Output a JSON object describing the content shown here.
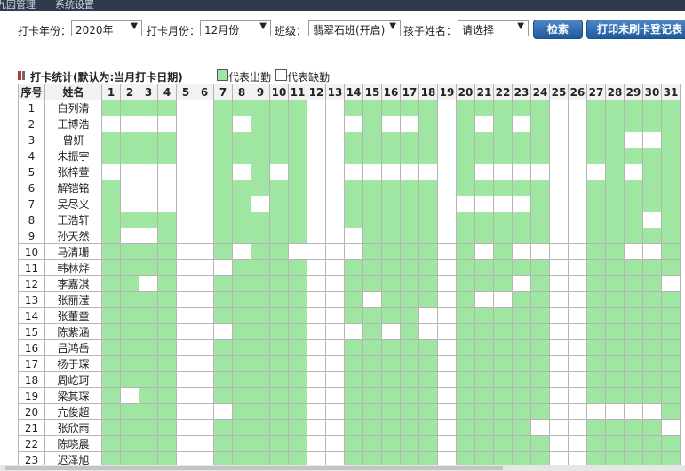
{
  "nav": [
    "九园管理",
    "系统设置"
  ],
  "filters": {
    "year_label": "打卡年份：",
    "year_value": "2020年",
    "month_label": "打卡月份：",
    "month_value": "12月份",
    "class_label": "班级：",
    "class_value": "翡翠石班(开启)",
    "child_label": "孩子姓名：",
    "child_value": "请选择",
    "search_btn": "检索",
    "print_btn": "打印未刷卡登记表"
  },
  "section": {
    "title": "打卡统计(默认为:当月打卡日期)",
    "legend_present": "代表出勤",
    "legend_absent": "代表缺勤"
  },
  "colors": {
    "present": "#9ee6a1",
    "absent": "#ffffff",
    "button": "#1f5a9e"
  },
  "table": {
    "col_index": "序号",
    "col_name": "姓名",
    "days": [
      "1",
      "2",
      "3",
      "4",
      "5",
      "6",
      "7",
      "8",
      "9",
      "10",
      "11",
      "12",
      "13",
      "14",
      "15",
      "16",
      "17",
      "18",
      "19",
      "20",
      "21",
      "22",
      "23",
      "24",
      "25",
      "26",
      "27",
      "28",
      "29",
      "30",
      "31"
    ],
    "rows": [
      {
        "no": "1",
        "name": "白列清",
        "att": "1111001111100111110111110011111"
      },
      {
        "no": "2",
        "name": "王博浩",
        "att": "0000001011100010010101010011111"
      },
      {
        "no": "3",
        "name": "曾妍",
        "att": "1111001111100111110111110011001"
      },
      {
        "no": "4",
        "name": "朱振宇",
        "att": "1111001111100111110111110011111"
      },
      {
        "no": "5",
        "name": "张梓萱",
        "att": "0000001010100000000100000001011"
      },
      {
        "no": "6",
        "name": "解铠铭",
        "att": "1000001111100111110111110011111"
      },
      {
        "no": "7",
        "name": "吴尽义",
        "att": "1000001101100111110000010011111"
      },
      {
        "no": "8",
        "name": "王浩轩",
        "att": "1111001111100111110111110011101"
      },
      {
        "no": "9",
        "name": "孙天然",
        "att": "1001001111100011110111110011111"
      },
      {
        "no": "10",
        "name": "马清珊",
        "att": "1111001011000011110101000011001"
      },
      {
        "no": "11",
        "name": "韩林烨",
        "att": "1111000111100111110111110011111"
      },
      {
        "no": "12",
        "name": "李嘉淇",
        "att": "1101001111100111110111010011110"
      },
      {
        "no": "13",
        "name": "张丽滢",
        "att": "1111001111100101110100110011111"
      },
      {
        "no": "14",
        "name": "张董童",
        "att": "1111001111100111100111110011111"
      },
      {
        "no": "15",
        "name": "陈紫涵",
        "att": "1111000111100010100111110011111"
      },
      {
        "no": "16",
        "name": "吕鸿岳",
        "att": "1111001111100111110111110011111"
      },
      {
        "no": "17",
        "name": "杨于琛",
        "att": "1111001111100111110111110011111"
      },
      {
        "no": "18",
        "name": "周屹珂",
        "att": "1111001111100111110111110011111"
      },
      {
        "no": "19",
        "name": "梁其琛",
        "att": "1011001111100111110111110011111"
      },
      {
        "no": "20",
        "name": "亢俊超",
        "att": "1111000111100111110111110000001"
      },
      {
        "no": "21",
        "name": "张欣雨",
        "att": "1111001111100111110111100011110"
      },
      {
        "no": "22",
        "name": "陈晓晨",
        "att": "1111001111100111110111110011111"
      },
      {
        "no": "23",
        "name": "迟泽旭",
        "att": "1111001111100111110111110011111"
      }
    ]
  }
}
